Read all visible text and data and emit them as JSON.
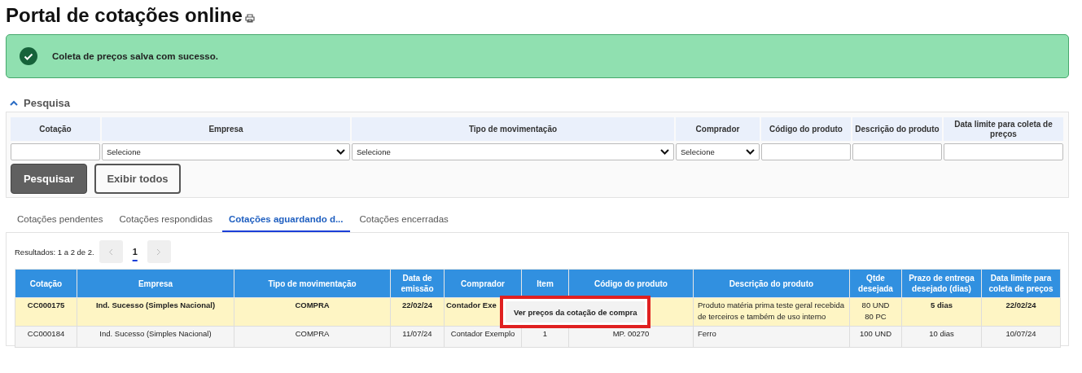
{
  "page_title": "Portal de cotações online",
  "alert": {
    "kind": "success",
    "message": "Coleta de preços salva com sucesso."
  },
  "search": {
    "title": "Pesquisa",
    "expanded": true,
    "fields": [
      {
        "label": "Cotação",
        "kind": "text"
      },
      {
        "label": "Empresa",
        "kind": "select",
        "value": "Selecione"
      },
      {
        "label": "Tipo de movimentação",
        "kind": "select",
        "value": "Selecione"
      },
      {
        "label": "Comprador",
        "kind": "select",
        "value": "Selecione"
      },
      {
        "label": "Código do produto",
        "kind": "text"
      },
      {
        "label": "Descrição do produto",
        "kind": "text"
      },
      {
        "label": "Data limite para coleta de preços",
        "kind": "text"
      }
    ],
    "buttons": [
      {
        "label": "Pesquisar",
        "kind": "primary"
      },
      {
        "label": "Exibir todos",
        "kind": "secondary"
      }
    ]
  },
  "tabs": [
    {
      "label": "Cotações pendentes",
      "selected": false
    },
    {
      "label": "Cotações respondidas",
      "selected": false
    },
    {
      "label": "Cotações aguardando d...",
      "selected": true
    },
    {
      "label": "Cotações encerradas",
      "selected": false
    }
  ],
  "results_text": "Resultados: 1 a 2 de 2.",
  "pagination": {
    "pages": [
      {
        "label": "1",
        "selected": true
      }
    ]
  },
  "table": {
    "columns": [
      "Cotação",
      "Empresa",
      "Tipo de movimentação",
      "Data de emissão",
      "Comprador",
      "Item",
      "Código do produto",
      "Descrição do produto",
      "Qtde desejada",
      "Prazo de entrega desejado (dias)",
      "Data limite para coleta de preços"
    ],
    "rows": [
      {
        "selected": true,
        "cells": [
          "CC000175",
          "Ind. Sucesso (Simples Nacional)",
          "COMPRA",
          "22/02/24",
          "Contador Exe",
          null,
          null,
          "Produto matéria prima teste geral recebida de terceiros e também de uso interno",
          [
            "80 UND",
            "80 PC"
          ],
          "5 dias",
          "22/02/24"
        ]
      },
      {
        "selected": false,
        "cells": [
          "CC000184",
          "Ind. Sucesso (Simples Nacional)",
          "COMPRA",
          "11/07/24",
          "Contador Exemplo",
          "1",
          "MP. 00270",
          "Ferro",
          [
            "100 UND"
          ],
          "10 dias",
          "10/07/24"
        ]
      }
    ]
  },
  "context_menu": {
    "items": [
      "Ver preços da cotação de compra"
    ]
  }
}
